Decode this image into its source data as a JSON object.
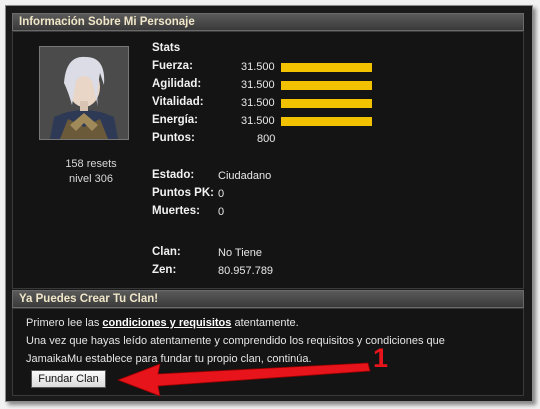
{
  "info_section": {
    "title": "Información Sobre Mi Personaje"
  },
  "character": {
    "resets": "158 resets",
    "level": "nivel 306"
  },
  "stats": {
    "heading": "Stats",
    "rows": [
      {
        "label": "Fuerza:",
        "value": "31.500",
        "fill": 1.0
      },
      {
        "label": "Agilidad:",
        "value": "31.500",
        "fill": 1.0
      },
      {
        "label": "Vitalidad:",
        "value": "31.500",
        "fill": 1.0
      },
      {
        "label": "Energía:",
        "value": "31.500",
        "fill": 1.0
      }
    ],
    "points_label": "Puntos:",
    "points_value": "800",
    "bar_color": "#f2c200"
  },
  "status": [
    {
      "label": "Estado:",
      "value": "Ciudadano"
    },
    {
      "label": "Puntos PK:",
      "value": "0"
    },
    {
      "label": "Muertes:",
      "value": "0"
    }
  ],
  "clan": {
    "clan_label": "Clan:",
    "clan_value": "No Tiene",
    "zen_label": "Zen:",
    "zen_value": "80.957.789"
  },
  "clan_section": {
    "title": "Ya Puedes Crear Tu Clan!",
    "line1_pre": "Primero lee las ",
    "line1_link": "condiciones y requisitos",
    "line1_post": " atentamente.",
    "line2": "Una vez que hayas leído atentamente y comprendido los requisitos y condiciones que",
    "line3": "JamaikaMu establece para fundar tu propio clan, continúa.",
    "button_label": "Fundar Clan"
  },
  "annotation": {
    "number": "1",
    "color": "#e8141c"
  }
}
